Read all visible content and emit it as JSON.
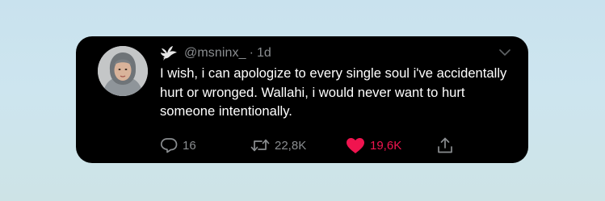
{
  "tweet": {
    "handle": "@msninx_",
    "separator": "·",
    "time": "1d",
    "text": "I wish, i can apologize to every single soul i've accidentally hurt or wronged. Wallahi, i would never want to hurt someone intentionally.",
    "stats": {
      "replies": "16",
      "retweets": "22,8K",
      "likes": "19,6K"
    },
    "liked": true
  },
  "icons": {
    "name_emoji": "dove-icon",
    "more": "chevron-down-icon",
    "reply": "reply-icon",
    "retweet": "retweet-icon",
    "like": "heart-icon",
    "share": "share-icon"
  },
  "colors": {
    "background_top": "#c9e2ee",
    "card": "#000000",
    "text": "#ffffff",
    "muted": "#8a8d90",
    "like": "#f0144f"
  }
}
